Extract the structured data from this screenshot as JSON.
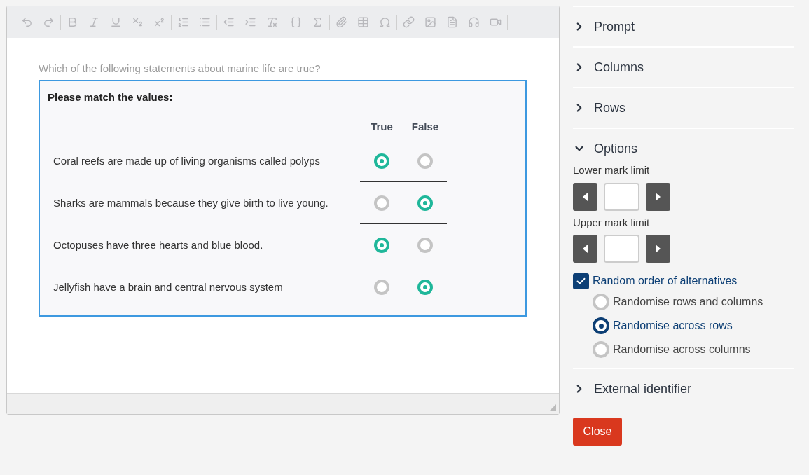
{
  "editor": {
    "prompt": "Which of the following statements about marine life are true?",
    "matrix": {
      "title": "Please match the values:",
      "columns": [
        "True",
        "False"
      ],
      "rows": [
        {
          "label": "Coral reefs are made up of living organisms called polyps",
          "answers": [
            {
              "selected": true
            },
            {
              "selected": false
            }
          ]
        },
        {
          "label": "Sharks are mammals because they give birth to live young.",
          "answers": [
            {
              "selected": false
            },
            {
              "selected": true
            }
          ]
        },
        {
          "label": "Octopuses have three hearts and blue blood.",
          "answers": [
            {
              "selected": true
            },
            {
              "selected": false
            }
          ]
        },
        {
          "label": "Jellyfish have a brain and central nervous system",
          "answers": [
            {
              "selected": false
            },
            {
              "selected": true
            }
          ]
        }
      ]
    }
  },
  "sidebar": {
    "sections": [
      {
        "title": "Prompt",
        "expanded": false
      },
      {
        "title": "Columns",
        "expanded": false
      },
      {
        "title": "Rows",
        "expanded": false
      },
      {
        "title": "Options",
        "expanded": true
      }
    ],
    "options": {
      "steppers": [
        {
          "label": "Lower mark limit"
        },
        {
          "label": "Upper mark limit"
        }
      ],
      "random_order": {
        "label": "Random order of alternatives",
        "checked": true
      },
      "radios": [
        {
          "label": "Randomise rows and columns",
          "selected": false
        },
        {
          "label": "Randomise across rows",
          "selected": true
        },
        {
          "label": "Randomise across columns",
          "selected": false
        }
      ]
    },
    "after_sections": [
      {
        "title": "External identifier",
        "expanded": false
      }
    ],
    "close_button": "Close"
  }
}
